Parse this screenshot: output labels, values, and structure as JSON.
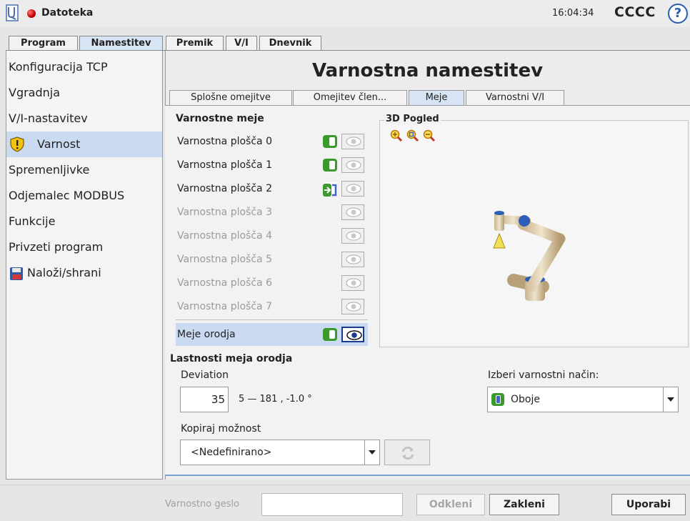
{
  "topbar": {
    "file_menu": "Datoteka",
    "clock": "16:04:34",
    "robot_name": "CCCC",
    "help_glyph": "?"
  },
  "main_tabs": [
    {
      "label": "Program",
      "active": false
    },
    {
      "label": "Namestitev",
      "active": true
    },
    {
      "label": "Premik",
      "active": false
    },
    {
      "label": "V/I",
      "active": false
    },
    {
      "label": "Dnevnik",
      "active": false
    }
  ],
  "sidebar": {
    "items": [
      {
        "label": "Konfiguracija TCP",
        "icon": ""
      },
      {
        "label": "Vgradnja",
        "icon": ""
      },
      {
        "label": "V/I-nastavitev",
        "icon": ""
      },
      {
        "label": "Varnost",
        "icon": "warning-shield-icon",
        "active": true
      },
      {
        "label": "Spremenljivke",
        "icon": ""
      },
      {
        "label": "Odjemalec MODBUS",
        "icon": ""
      },
      {
        "label": "Funkcije",
        "icon": ""
      },
      {
        "label": "Privzeti program",
        "icon": ""
      },
      {
        "label": "Naloži/shrani",
        "icon": "floppy-disk-icon"
      }
    ]
  },
  "page": {
    "title": "Varnostna namestitev"
  },
  "sub_tabs": [
    {
      "label": "Splošne omejitve",
      "active": false
    },
    {
      "label": "Omejitev člen...",
      "active": false
    },
    {
      "label": "Meje",
      "active": true
    },
    {
      "label": "Varnostni V/I",
      "active": false
    }
  ],
  "bounds": {
    "heading": "Varnostne meje",
    "planes": [
      {
        "label": "Varnostna plošča 0",
        "state": "enabled"
      },
      {
        "label": "Varnostna plošča 1",
        "state": "enabled"
      },
      {
        "label": "Varnostna plošča 2",
        "state": "trigger"
      },
      {
        "label": "Varnostna plošča 3",
        "state": "disabled"
      },
      {
        "label": "Varnostna plošča 4",
        "state": "disabled"
      },
      {
        "label": "Varnostna plošča 5",
        "state": "disabled"
      },
      {
        "label": "Varnostna plošča 6",
        "state": "disabled"
      },
      {
        "label": "Varnostna plošča 7",
        "state": "disabled"
      }
    ],
    "tool": {
      "label": "Meje orodja",
      "state": "enabled",
      "visible": true
    }
  },
  "view3d": {
    "label": "3D Pogled",
    "zoom_icons": [
      "zoom-in-icon",
      "zoom-fit-icon",
      "zoom-out-icon"
    ]
  },
  "props": {
    "heading": "Lastnosti meja orodja",
    "deviation_label": "Deviation",
    "deviation_value": "35",
    "deviation_range": "5 — 181 , -1.0 °",
    "copy_label": "Kopiraj možnost",
    "copy_value": "<Nedefinirano>",
    "mode_label": "Izberi varnostni način:",
    "mode_value": "Oboje"
  },
  "bottom": {
    "password_label": "Varnostno geslo",
    "password_value": "",
    "unlock": "Odkleni",
    "lock": "Zakleni",
    "apply": "Uporabi"
  },
  "colors": {
    "accent": "#7aa5d8",
    "selected": "#c9daf1",
    "toggle_on": "#3a9a2c",
    "status_red": "#c00000"
  }
}
